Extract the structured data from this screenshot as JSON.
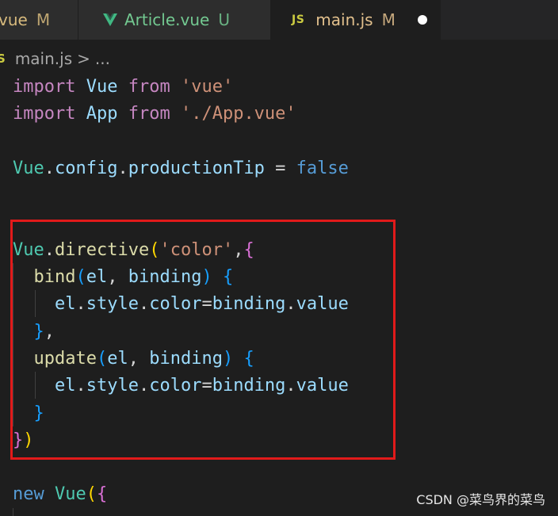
{
  "tabs": [
    {
      "name": "vue",
      "status": "M"
    },
    {
      "name": "Article.vue",
      "status": "U"
    },
    {
      "name": "main.js",
      "status": "M",
      "icon": "JS"
    }
  ],
  "breadcrumb": {
    "icon": "S",
    "file": "main.js",
    "sep": ">",
    "more": "..."
  },
  "code": {
    "l1": {
      "a": "import",
      "b": "Vue",
      "c": "from",
      "d": "'vue'"
    },
    "l2": {
      "a": "import",
      "b": "App",
      "c": "from",
      "d": "'./App.vue'"
    },
    "l4": {
      "a": "Vue",
      "b": ".",
      "c": "config",
      "d": ".",
      "e": "productionTip",
      "f": " = ",
      "g": "false"
    },
    "l7": {
      "a": "Vue",
      "b": ".",
      "c": "directive",
      "d": "(",
      "e": "'color'",
      "f": ",",
      "g": "{"
    },
    "l8": {
      "a": "bind",
      "b": "(",
      "c": "el",
      "d": ", ",
      "e": "binding",
      "f": ") ",
      "g": "{"
    },
    "l9": {
      "a": "el",
      "b": ".",
      "c": "style",
      "d": ".",
      "e": "color",
      "f": "=",
      "g": "binding",
      "h": ".",
      "i": "value"
    },
    "l10": {
      "a": "}",
      "b": ","
    },
    "l11": {
      "a": "update",
      "b": "(",
      "c": "el",
      "d": ", ",
      "e": "binding",
      "f": ") ",
      "g": "{"
    },
    "l12": {
      "a": "el",
      "b": ".",
      "c": "style",
      "d": ".",
      "e": "color",
      "f": "=",
      "g": "binding",
      "h": ".",
      "i": "value"
    },
    "l13": {
      "a": "}"
    },
    "l14": {
      "a": "}",
      "b": ")"
    },
    "l16": {
      "a": "new",
      "b": "Vue",
      "c": "(",
      "d": "{"
    }
  },
  "watermark": "CSDN @菜鸟界的菜鸟"
}
